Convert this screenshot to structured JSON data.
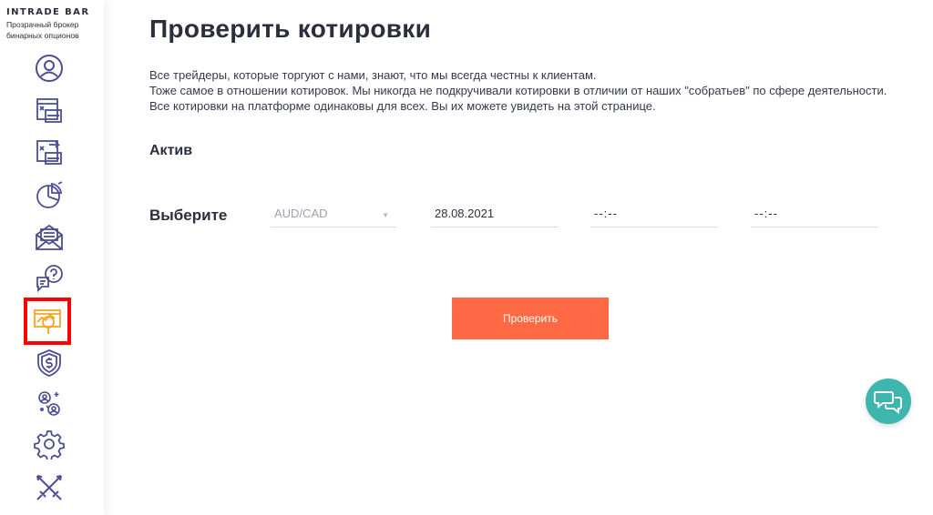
{
  "logo": {
    "title": "INTRADE BAR",
    "subtitle_line1": "Прозрачный брокер",
    "subtitle_line2": "бинарных опционов"
  },
  "sidebar": {
    "items": [
      {
        "icon": "user-circle-icon"
      },
      {
        "icon": "deposit-icon"
      },
      {
        "icon": "withdraw-icon"
      },
      {
        "icon": "pie-chart-icon"
      },
      {
        "icon": "mail-icon"
      },
      {
        "icon": "faq-chat-icon"
      },
      {
        "icon": "check-quotes-icon",
        "active": true
      },
      {
        "icon": "shield-dollar-icon"
      },
      {
        "icon": "referral-icon"
      },
      {
        "icon": "settings-gear-icon"
      },
      {
        "icon": "crossed-swords-icon"
      }
    ],
    "active_color": "#ff0000",
    "icon_color": "#4b4f8f",
    "active_icon_color": "#f5a623"
  },
  "page": {
    "title": "Проверить котировки",
    "description_line1": "Все трейдеры, которые торгуют с нами, знают, что мы всегда честны к клиентам.",
    "description_line2": "Тоже самое в отношении котировок. Мы никогда не подкручивали котировки в отличии от наших \"собратьев\" по сфере деятельности. Все котировки на платформе одинаковы для всех. Вы их можете увидеть на этой странице.",
    "section_label": "Актив",
    "select_label": "Выберите"
  },
  "form": {
    "asset_value": "AUD/CAD",
    "date_value": "28.08.2021",
    "time_from": "--:--",
    "time_to": "--:--",
    "submit_label": "Проверить",
    "submit_color": "#ff6a45"
  },
  "chat": {
    "icon": "chat-bubbles-icon",
    "color": "#3fb6ad"
  }
}
